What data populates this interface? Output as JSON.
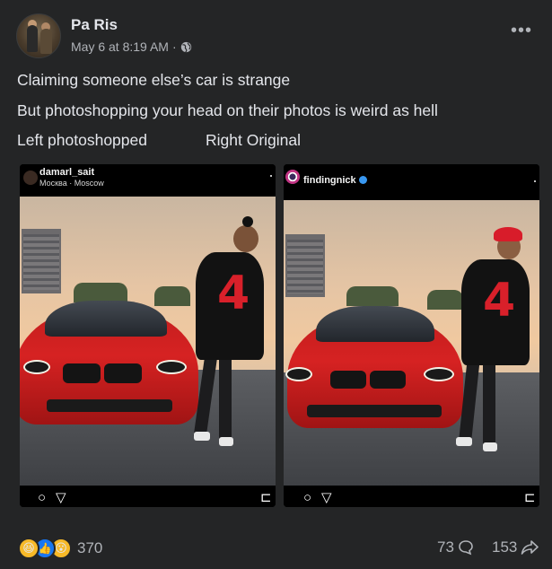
{
  "post": {
    "author": "Pa Ris",
    "timestamp": "May 6 at 8:19 AM",
    "separator": "·",
    "privacy_icon": "globe-icon",
    "more_icon": "more-options-icon",
    "lines": [
      "Claiming someone else’s car is strange",
      "But photoshopping your head on their photos is weird as hell"
    ],
    "caption_left": "Left photoshopped",
    "caption_right": "Right Original"
  },
  "photos": {
    "left": {
      "username": "damarl_sait",
      "location": "Москва · Moscow",
      "icons": [
        "comment-icon",
        "share-icon",
        "save-icon"
      ]
    },
    "right": {
      "username": "findingnick",
      "verified": true,
      "icons": [
        "comment-icon",
        "share-icon",
        "save-icon"
      ]
    }
  },
  "footer": {
    "reactions": [
      "haha-icon",
      "like-icon",
      "wow-icon"
    ],
    "reaction_count": "370",
    "comment_count": "73",
    "share_count": "153"
  },
  "colors": {
    "background": "#242526",
    "text": "#e4e6eb",
    "secondary_text": "#b0b3b8",
    "accent_blue": "#1877f2",
    "car_red": "#c41e1e"
  }
}
